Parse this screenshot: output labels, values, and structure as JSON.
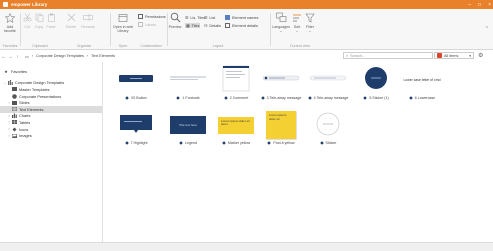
{
  "window": {
    "title": "empower Library",
    "controls": [
      "–",
      "□",
      "×"
    ]
  },
  "ribbon": {
    "add_favorite": "Add favorite",
    "cut": "Cut",
    "copy": "Copy",
    "paste": "Paste",
    "delete": "Delete",
    "rename": "Rename",
    "open_library": "Open in web Library",
    "permissions": "Permissions",
    "labels": "Labels",
    "preview": "Preview",
    "view_list": "Lis. Tiles",
    "view_list2": "List",
    "view_tiles": "Tiles",
    "details": "Details",
    "element_names": "Element names",
    "element_details": "Element details",
    "languages": "Languages",
    "sort": "Sort",
    "filter": "Filter",
    "groups": {
      "favorites": "Favorites",
      "clipboard": "Clipboard",
      "organize": "Organize",
      "open": "Open",
      "collaboration": "Collaboration",
      "layout": "Layout",
      "current_view": "Current view"
    }
  },
  "address": {
    "crumbs": [
      "Corporate Design Templates",
      "Text Elements"
    ],
    "search_placeholder": "Search...",
    "filter_value": "All items"
  },
  "tree": {
    "favorites": "Favorites",
    "root": "Corporate Design Templates",
    "children": [
      "Master Templates",
      "Corporate Presentations",
      "Slides",
      "Text Elements",
      "Charts",
      "Tables",
      "Icons",
      "Images"
    ]
  },
  "items": [
    {
      "label": "00 Button"
    },
    {
      "label": "1 Footnote"
    },
    {
      "label": "2 Comment"
    },
    {
      "label": "3 Tele-away message"
    },
    {
      "label": "4 Tele-away message"
    },
    {
      "label": "5 Sticker (1)"
    },
    {
      "label": "6 Lowercase",
      "thumb_text": "Lower case letter of cmd"
    },
    {
      "label": "7 Highlight"
    },
    {
      "label": "Legend",
      "thumb_text": "Title text here"
    },
    {
      "label": "Marker yellow",
      "thumb_text": "Lorem ipsum dolor sit amet"
    },
    {
      "label": "Post-it yellow",
      "thumb_text": "Lorem ipsum dolor sit"
    },
    {
      "label": "Sticker"
    }
  ],
  "colors": {
    "titlebar": "#e8812a",
    "navy": "#1f3d6b",
    "yellow": "#f5d033"
  }
}
